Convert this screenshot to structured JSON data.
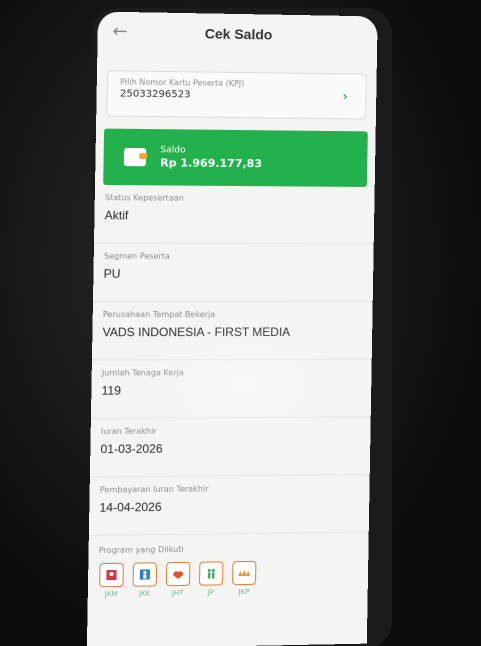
{
  "header": {
    "title": "Cek Saldo",
    "back_icon": "arrow-left-icon"
  },
  "kpj": {
    "label": "Pilih Nomor Kartu Peserta (KPJ)",
    "value": "25033296523"
  },
  "saldo": {
    "label": "Saldo",
    "value": "Rp 1.969.177,83",
    "color": "#22b14c"
  },
  "fields": [
    {
      "label": "Status Kepesertaan",
      "value": "Aktif"
    },
    {
      "label": "Segmen Peserta",
      "value": "PU"
    },
    {
      "label": "Perusahaan Tempat Bekerja",
      "value": "VADS INDONESIA - FIRST MEDIA"
    },
    {
      "label": "Jumlah Tenaga Kerja",
      "value": "119"
    },
    {
      "label": "Iuran Terakhir",
      "value": "01-03-2026"
    },
    {
      "label": "Pembayaran Iuran Terakhir",
      "value": "14-04-2026"
    }
  ],
  "programs": {
    "label": "Program yang Diikuti",
    "items": [
      {
        "name": "JKM",
        "icon": "jkm-icon"
      },
      {
        "name": "JKK",
        "icon": "jkk-icon"
      },
      {
        "name": "JHT",
        "icon": "jht-icon"
      },
      {
        "name": "JP",
        "icon": "jp-icon"
      },
      {
        "name": "JKP",
        "icon": "jkp-icon"
      }
    ]
  }
}
